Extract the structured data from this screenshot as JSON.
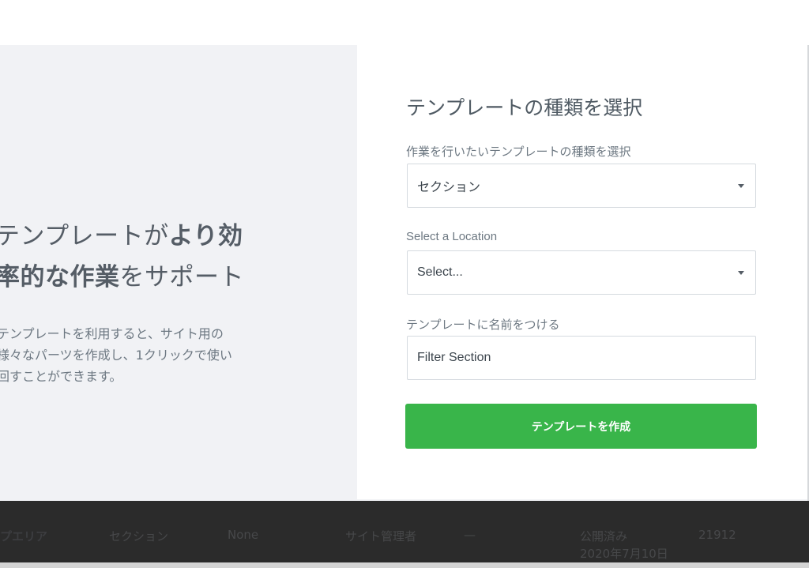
{
  "left": {
    "headline_part1": "テンプレートが",
    "headline_bold1": "より効",
    "headline_bold2": "率的な作業",
    "headline_part2": "をサポート",
    "description_line1": "テンプレートを利用すると、サイト用の",
    "description_line2": "様々なパーツを作成し、1クリックで使い",
    "description_line3": "回すことができます。"
  },
  "modal": {
    "title": "テンプレートの種類を選択",
    "type_label": "作業を行いたいテンプレートの種類を選択",
    "type_value": "セクション",
    "location_label": "Select a Location",
    "location_value": "Select...",
    "name_label": "テンプレートに名前をつける",
    "name_value": "Filter Section",
    "create_label": "テンプレートを作成"
  },
  "background_row": {
    "title": "プエリア",
    "type": "セクション",
    "condition": "None",
    "author": "サイト管理者",
    "dash": "—",
    "status": "公開済み",
    "date": "2020年7月10日",
    "id": "21912"
  },
  "colors": {
    "button": "#39b54a",
    "panel_bg": "#f1f2f5",
    "footer_bg": "#2b2b2b"
  },
  "icons": {
    "caret": "chevron-down-icon"
  }
}
